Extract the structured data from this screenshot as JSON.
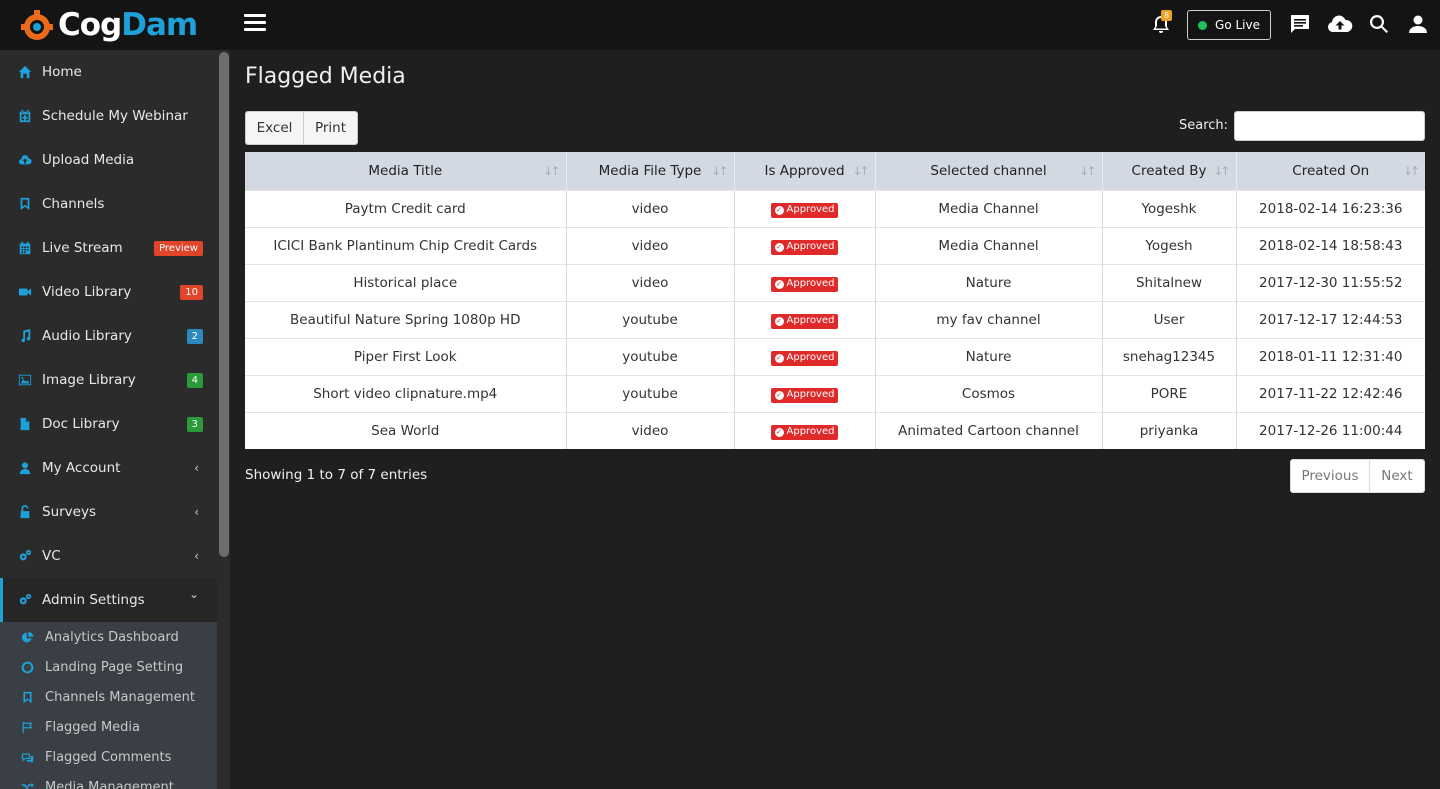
{
  "brand": {
    "part1": "Cog",
    "part2": "Dam"
  },
  "sidebar": {
    "items": [
      {
        "label": "Home",
        "icon": "home-icon"
      },
      {
        "label": "Schedule My Webinar",
        "icon": "calendar-plus-icon"
      },
      {
        "label": "Upload Media",
        "icon": "cloud-upload-icon"
      },
      {
        "label": "Channels",
        "icon": "bookmark-icon"
      },
      {
        "label": "Live Stream",
        "icon": "calendar-icon",
        "badge": "Preview",
        "badge_color": "#e0452a"
      },
      {
        "label": "Video Library",
        "icon": "video-camera-icon",
        "badge": "10",
        "badge_color": "#e0452a"
      },
      {
        "label": "Audio Library",
        "icon": "music-icon",
        "badge": "2",
        "badge_color": "#2a8ac0"
      },
      {
        "label": "Image Library",
        "icon": "image-icon",
        "badge": "4",
        "badge_color": "#2a9a3a"
      },
      {
        "label": "Doc Library",
        "icon": "file-icon",
        "badge": "3",
        "badge_color": "#2a9a3a"
      },
      {
        "label": "My Account",
        "icon": "user-icon",
        "chevron": "‹"
      },
      {
        "label": "Surveys",
        "icon": "unlock-icon",
        "chevron": "‹"
      },
      {
        "label": "VC",
        "icon": "cogs-icon",
        "chevron": "‹"
      },
      {
        "label": "Admin Settings",
        "icon": "cogs-icon",
        "chevron": "⌄"
      }
    ],
    "subitems": [
      {
        "label": "Analytics Dashboard",
        "icon": "pie-chart-icon"
      },
      {
        "label": "Landing Page Setting",
        "icon": "circle-icon"
      },
      {
        "label": "Channels Management",
        "icon": "bookmark-icon"
      },
      {
        "label": "Flagged Media",
        "icon": "flag-icon"
      },
      {
        "label": "Flagged Comments",
        "icon": "comments-icon"
      },
      {
        "label": "Media Management",
        "icon": "random-icon"
      }
    ]
  },
  "topbar": {
    "go_live": "Go Live",
    "notification_count": "8"
  },
  "main": {
    "title": "Flagged Media",
    "excel": "Excel",
    "print": "Print",
    "search_label": "Search:",
    "columns": [
      "Media Title",
      "Media File Type",
      "Is Approved",
      "Selected channel",
      "Created By",
      "Created On"
    ],
    "rows": [
      [
        "Paytm Credit card",
        "video",
        "Approved",
        "Media Channel",
        "Yogeshk",
        "2018-02-14 16:23:36"
      ],
      [
        "ICICI Bank Plantinum Chip Credit Cards",
        "video",
        "Approved",
        "Media Channel",
        "Yogesh",
        "2018-02-14 18:58:43"
      ],
      [
        "Historical place",
        "video",
        "Approved",
        "Nature",
        "Shitalnew",
        "2017-12-30 11:55:52"
      ],
      [
        "Beautiful Nature Spring 1080p HD",
        "youtube",
        "Approved",
        "my fav channel",
        "User",
        "2017-12-17 12:44:53"
      ],
      [
        "Piper First Look",
        "youtube",
        "Approved",
        "Nature",
        "snehag12345",
        "2018-01-11 12:31:40"
      ],
      [
        "Short video clipnature.mp4",
        "youtube",
        "Approved",
        "Cosmos",
        "PORE",
        "2017-11-22 12:42:46"
      ],
      [
        "Sea World",
        "video",
        "Approved",
        "Animated Cartoon channel",
        "priyanka",
        "2017-12-26 11:00:44"
      ]
    ],
    "info": "Showing 1 to 7 of 7 entries",
    "prev": "Previous",
    "next": "Next"
  }
}
